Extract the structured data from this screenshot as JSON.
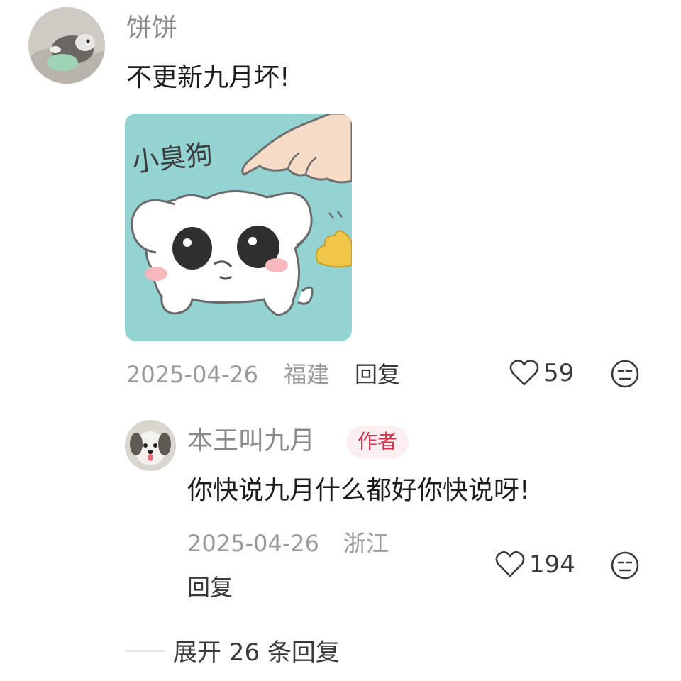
{
  "main_comment": {
    "username": "饼饼",
    "text": "不更新九月坏!",
    "sticker_text": "小臭狗",
    "date": "2025-04-26",
    "location": "福建",
    "reply_label": "回复",
    "like_count": "59"
  },
  "reply": {
    "username": "本王叫九月",
    "badge": "作者",
    "text": "你快说九月什么都好你快说呀!",
    "date": "2025-04-26",
    "location": "浙江",
    "reply_label": "回复",
    "like_count": "194"
  },
  "expand_label": "展开 26 条回复",
  "colors": {
    "badge_text": "#d6324e",
    "badge_bg": "#fbeff1",
    "sticker_bg": "#93d4d2",
    "meta_gray": "#9a9a9a"
  },
  "icons": [
    "heart-icon",
    "dislike-face-icon"
  ]
}
